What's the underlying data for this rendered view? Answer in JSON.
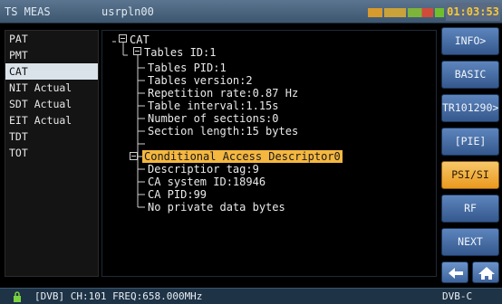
{
  "titlebar": {
    "mode": "TS MEAS",
    "file": "usrpln00",
    "clock": "01:03:53"
  },
  "left_menu": {
    "selected_index": 2,
    "items": [
      "PAT",
      "PMT",
      "CAT",
      "NIT Actual",
      "SDT Actual",
      "EIT Actual",
      "TDT",
      "TOT"
    ]
  },
  "tree": {
    "root": "CAT",
    "tables_id": "Tables ID:1",
    "tables_pid": "Tables PID:1",
    "tables_version": "Tables version:2",
    "repetition_rate": "Repetition rate:0.87 Hz",
    "table_interval": "Table interval:1.15s",
    "number_of_sections": "Number of sections:0",
    "section_length": "Section length:15 bytes",
    "descriptor": "Conditional Access Descriptor0",
    "descriptor_tag": "Descriptior tag:9",
    "ca_system_id": "CA system ID:18946",
    "ca_pid": "CA PID:99",
    "private_data": "No private data bytes"
  },
  "right_buttons": {
    "info": "INFO>",
    "basic": "BASIC",
    "tr101290": "TR101290>",
    "pie": "[PIE]",
    "psi_si": "PSI/SI",
    "rf": "RF",
    "next": "NEXT",
    "active": "PSI/SI"
  },
  "statusbar": {
    "text": "[DVB] CH:101 FREQ:658.000MHz",
    "standard": "DVB-C"
  },
  "colors": {
    "accent": "#f4b73f",
    "button_blue": "#4a72aa",
    "titlebar": "#4a6580"
  }
}
